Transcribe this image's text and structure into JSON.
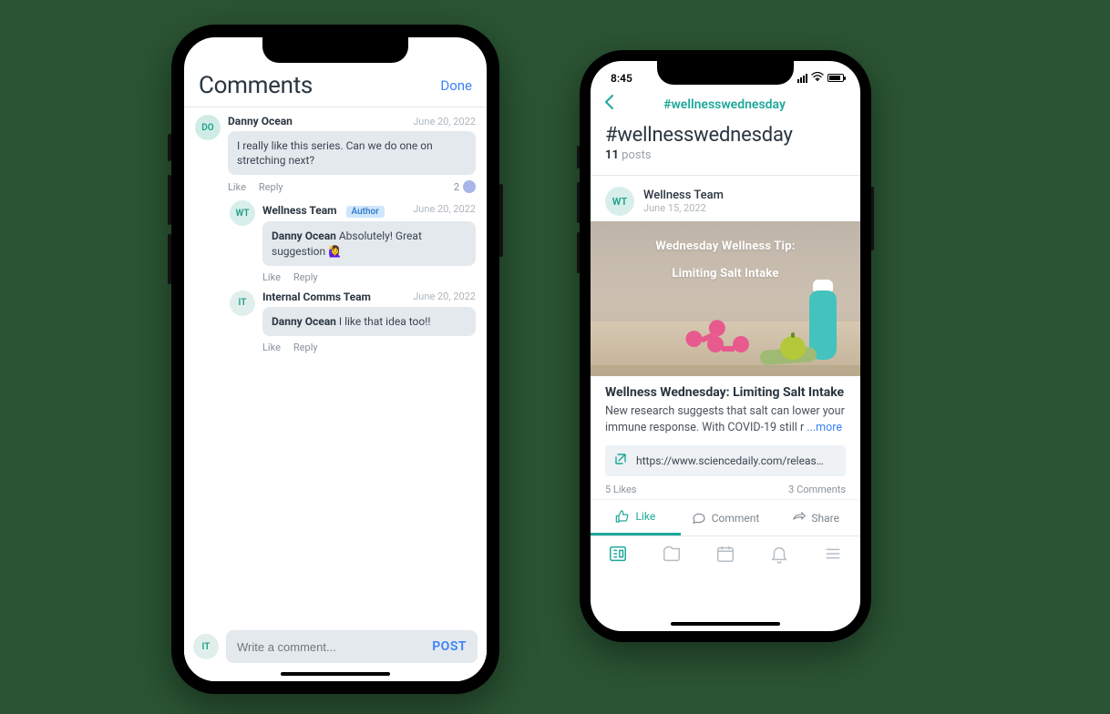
{
  "phone1": {
    "header": {
      "title": "Comments",
      "done": "Done"
    },
    "comments": [
      {
        "avatar": "DO",
        "name": "Danny Ocean",
        "date": "June 20, 2022",
        "text": "I really like this series. Can we do one on stretching next?",
        "like": "Like",
        "reply": "Reply",
        "like_count": "2"
      },
      {
        "avatar": "WT",
        "name": "Wellness Team",
        "author_badge": "Author",
        "date": "June 20, 2022",
        "mention": "Danny Ocean",
        "text": " Absolutely! Great suggestion 🙋‍♀️",
        "like": "Like",
        "reply": "Reply"
      },
      {
        "avatar": "IT",
        "name": "Internal Comms Team",
        "date": "June 20, 2022",
        "mention": "Danny Ocean",
        "text": " I like that idea too!!",
        "like": "Like",
        "reply": "Reply"
      }
    ],
    "compose": {
      "avatar": "IT",
      "placeholder": "Write a comment...",
      "post": "POST"
    }
  },
  "phone2": {
    "status_time": "8:45",
    "nav_title": "#wellnesswednesday",
    "hash_title": "#wellnesswednesday",
    "post_count_num": "11",
    "post_count_label": " posts",
    "post": {
      "avatar": "WT",
      "name": "Wellness Team",
      "date": "June 15, 2022",
      "hero_line1": "Wednesday Wellness Tip:",
      "hero_line2": "Limiting Salt Intake",
      "title": "Wellness Wednesday: Limiting Salt Intake",
      "body": "New research suggests that salt can lower your immune response. With COVID-19 still r",
      "more": "...more",
      "link_url": "https://www.sciencedaily.com/releas…",
      "likes": "5 Likes",
      "comments_count": "3 Comments",
      "action_like": "Like",
      "action_comment": "Comment",
      "action_share": "Share"
    }
  }
}
